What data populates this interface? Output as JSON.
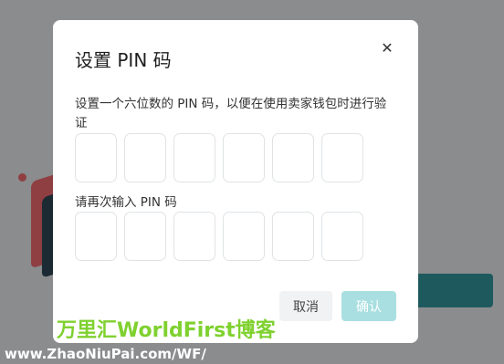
{
  "dialog": {
    "title": "设置 PIN 码",
    "close_icon": "close-icon",
    "description": "设置一个六位数的 PIN 码，以便在使用卖家钱包时进行验证",
    "pin_boxes": 6,
    "confirm_label_text": "请再次输入 PIN 码",
    "cancel_label": "取消",
    "confirm_label": "确认"
  },
  "watermark": {
    "line1": "万里汇WorldFirst博客",
    "line2": "www.ZhaoNiuPai.com/WF/"
  },
  "colors": {
    "overlay": "#8a8c8e",
    "confirm_disabled": "#a9dfe0",
    "cancel_bg": "#f1f2f4",
    "watermark_green": "#7fd12f"
  }
}
